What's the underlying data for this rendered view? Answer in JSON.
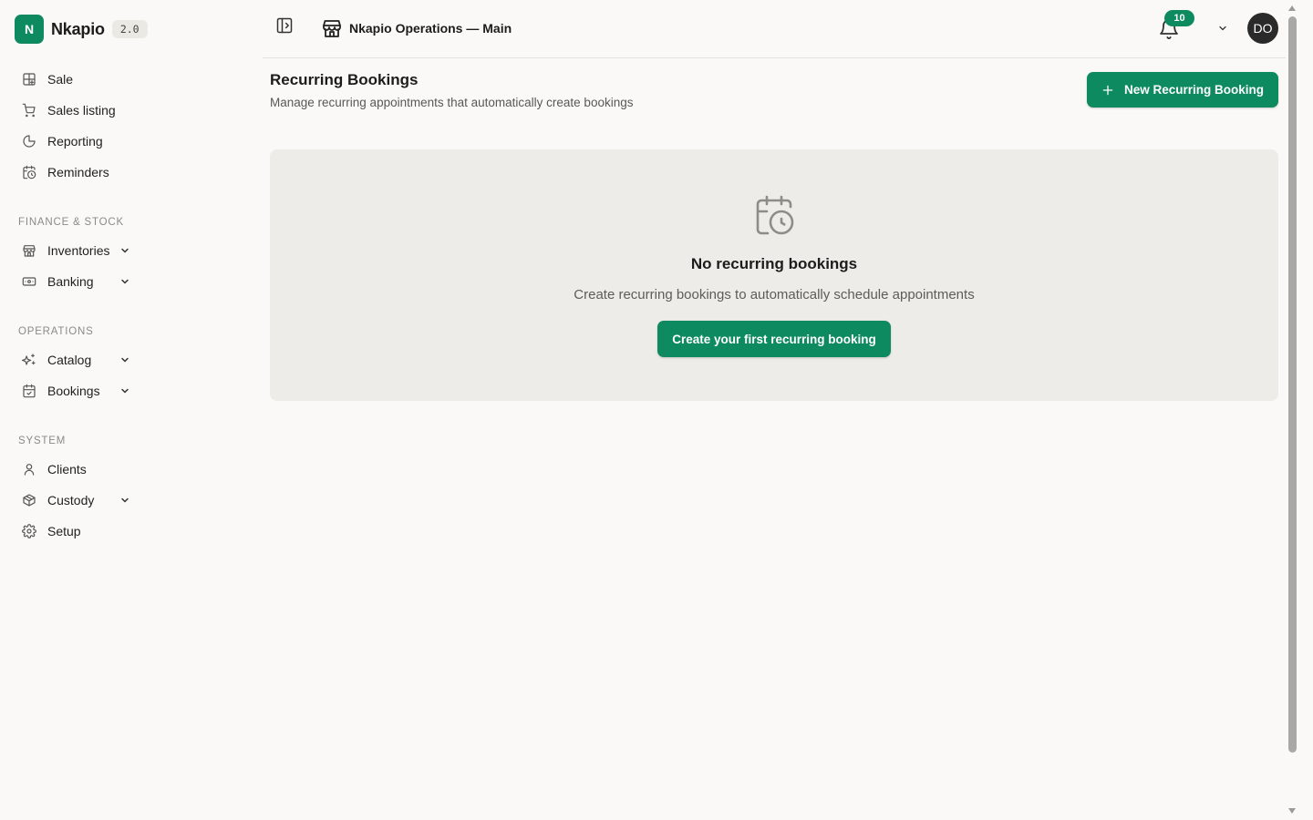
{
  "brand": {
    "logo_letter": "N",
    "name": "Nkapio",
    "version": "2.0"
  },
  "colors": {
    "accent": "#0d8a5f",
    "background": "#faf9f7",
    "card": "#eeece8"
  },
  "sidebar": {
    "primary": [
      {
        "label": "Sale",
        "icon": "grid-plus-icon"
      },
      {
        "label": "Sales listing",
        "icon": "cart-icon"
      },
      {
        "label": "Reporting",
        "icon": "pie-chart-icon"
      },
      {
        "label": "Reminders",
        "icon": "calendar-clock-icon"
      }
    ],
    "finance_label": "FINANCE & STOCK",
    "finance": [
      {
        "label": "Inventories",
        "icon": "warehouse-icon",
        "expandable": true
      },
      {
        "label": "Banking",
        "icon": "banknote-icon",
        "expandable": true
      }
    ],
    "operations_label": "OPERATIONS",
    "operations": [
      {
        "label": "Catalog",
        "icon": "sparkles-icon",
        "expandable": true
      },
      {
        "label": "Bookings",
        "icon": "calendar-check-icon",
        "expandable": true
      }
    ],
    "system_label": "SYSTEM",
    "system": [
      {
        "label": "Clients",
        "icon": "user-icon"
      },
      {
        "label": "Custody",
        "icon": "package-icon",
        "expandable": true
      },
      {
        "label": "Setup",
        "icon": "gear-icon"
      }
    ]
  },
  "topbar": {
    "store_name": "Nkapio Operations — Main",
    "notification_count": "10",
    "user_initials": "DO"
  },
  "page": {
    "title": "Recurring Bookings",
    "subtitle": "Manage recurring appointments that automatically create bookings",
    "new_button_label": "New Recurring Booking"
  },
  "empty_state": {
    "icon": "calendar-clock-icon",
    "title": "No recurring bookings",
    "text": "Create recurring bookings to automatically schedule appointments",
    "button_label": "Create your first recurring booking"
  }
}
